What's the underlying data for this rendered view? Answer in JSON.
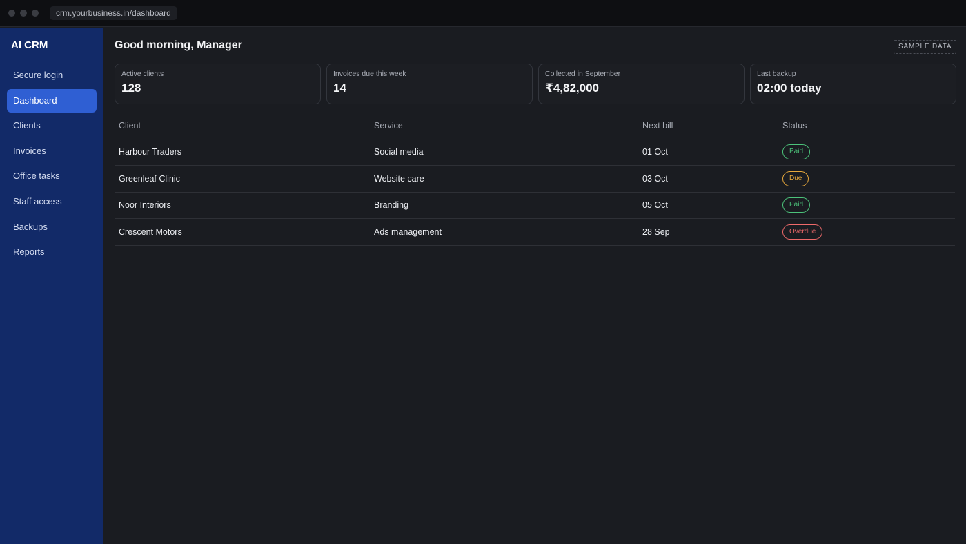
{
  "browser": {
    "url": "crm.yourbusiness.in/dashboard"
  },
  "sidebar": {
    "brand": "AI CRM",
    "items": [
      {
        "label": "Secure login",
        "active": false
      },
      {
        "label": "Dashboard",
        "active": true
      },
      {
        "label": "Clients",
        "active": false
      },
      {
        "label": "Invoices",
        "active": false
      },
      {
        "label": "Office tasks",
        "active": false
      },
      {
        "label": "Staff access",
        "active": false
      },
      {
        "label": "Backups",
        "active": false
      },
      {
        "label": "Reports",
        "active": false
      }
    ]
  },
  "header": {
    "greeting": "Good morning, Manager",
    "badge": "SAMPLE DATA"
  },
  "stats": [
    {
      "label": "Active clients",
      "value": "128"
    },
    {
      "label": "Invoices due this week",
      "value": "14"
    },
    {
      "label": "Collected in September",
      "value": "₹4,82,000"
    },
    {
      "label": "Last backup",
      "value": "02:00 today"
    }
  ],
  "table": {
    "headers": [
      "Client",
      "Service",
      "Next bill",
      "Status"
    ],
    "rows": [
      {
        "client": "Harbour Traders",
        "service": "Social media",
        "next_bill": "01 Oct",
        "status": "Paid"
      },
      {
        "client": "Greenleaf Clinic",
        "service": "Website care",
        "next_bill": "03 Oct",
        "status": "Due"
      },
      {
        "client": "Noor Interiors",
        "service": "Branding",
        "next_bill": "05 Oct",
        "status": "Paid"
      },
      {
        "client": "Crescent Motors",
        "service": "Ads management",
        "next_bill": "28 Sep",
        "status": "Overdue"
      }
    ]
  },
  "colors": {
    "sidebar_bg": "#122a68",
    "active_nav": "#2f5fd3",
    "page_bg": "#1a1c21",
    "status_paid": "#4cc27a",
    "status_due": "#e8a93c",
    "status_overdue": "#ef6a6a"
  }
}
